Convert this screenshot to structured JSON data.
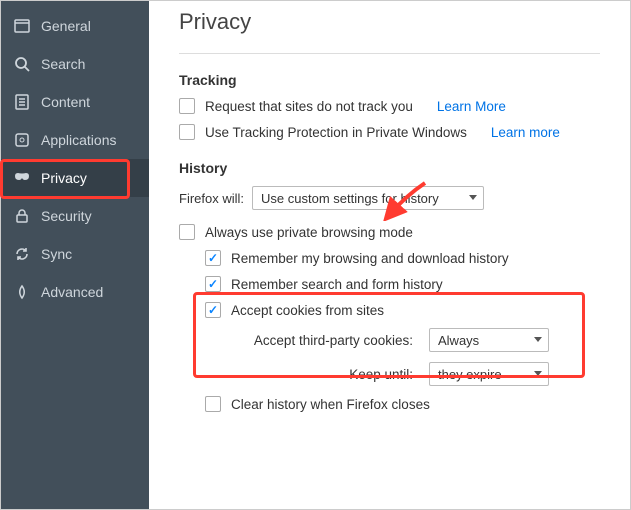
{
  "sidebar": {
    "items": [
      {
        "label": "General"
      },
      {
        "label": "Search"
      },
      {
        "label": "Content"
      },
      {
        "label": "Applications"
      },
      {
        "label": "Privacy"
      },
      {
        "label": "Security"
      },
      {
        "label": "Sync"
      },
      {
        "label": "Advanced"
      }
    ]
  },
  "page": {
    "title": "Privacy"
  },
  "tracking": {
    "heading": "Tracking",
    "do_not_track": {
      "label": "Request that sites do not track you",
      "checked": false,
      "learn_more": "Learn More"
    },
    "protection": {
      "label": "Use Tracking Protection in Private Windows",
      "checked": false,
      "learn_more": "Learn more"
    }
  },
  "history": {
    "heading": "History",
    "firefox_will_label": "Firefox will:",
    "firefox_will_value": "Use custom settings for history",
    "always_private": {
      "label": "Always use private browsing mode",
      "checked": false
    },
    "remember_browsing": {
      "label": "Remember my browsing and download history",
      "checked": true
    },
    "remember_search": {
      "label": "Remember search and form history",
      "checked": true
    },
    "accept_cookies": {
      "label": "Accept cookies from sites",
      "checked": true
    },
    "third_party_label": "Accept third-party cookies:",
    "third_party_value": "Always",
    "keep_until_label": "Keep until:",
    "keep_until_value": "they expire",
    "clear_on_close": {
      "label": "Clear history when Firefox closes",
      "checked": false
    }
  }
}
